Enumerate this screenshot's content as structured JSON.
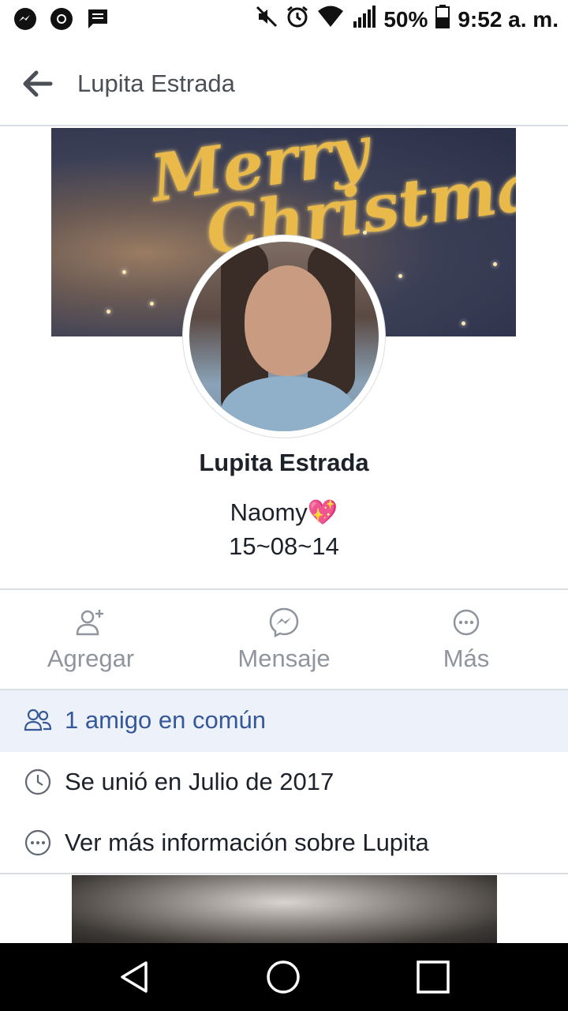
{
  "status_bar": {
    "battery": "50%",
    "time": "9:52 a. m.",
    "left_icons": [
      "messenger-icon",
      "chrome-icon",
      "message-icon"
    ],
    "right_icons": [
      "mute-icon",
      "alarm-icon",
      "wifi-icon",
      "signal-icon",
      "battery-icon"
    ]
  },
  "header": {
    "title": "Lupita Estrada",
    "back_icon": "back-arrow-icon"
  },
  "cover": {
    "text_line1": "Merry",
    "text_line2": "Christmas"
  },
  "profile": {
    "name": "Lupita Estrada",
    "bio_line1": "Naomy💖",
    "bio_line2": "15~08~14"
  },
  "actions": [
    {
      "label": "Agregar",
      "icon": "add-friend-icon"
    },
    {
      "label": "Mensaje",
      "icon": "messenger-icon"
    },
    {
      "label": "Más",
      "icon": "more-icon"
    }
  ],
  "info": {
    "mutual_friends": "1 amigo en común",
    "joined": "Se unió en Julio de 2017",
    "more_info": "Ver más información sobre Lupita"
  },
  "colors": {
    "link_blue": "#365899",
    "muted_gray": "#90949c",
    "highlight_row": "#edf2fa"
  }
}
